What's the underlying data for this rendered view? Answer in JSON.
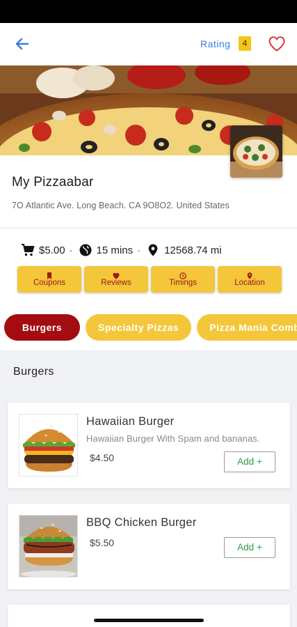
{
  "header": {
    "rating_label": "Rating",
    "rating_value": "4"
  },
  "store": {
    "name": "My Pizzaabar",
    "address": "7O Atlantic Ave. Long Beach. CA 9O8O2. United States"
  },
  "meta": {
    "price": "$5.00",
    "time": "15 mins",
    "distance": "12568.74 mi"
  },
  "actions": [
    {
      "label": "Coupons",
      "icon": "bookmark-icon"
    },
    {
      "label": "Reviews",
      "icon": "heart-icon"
    },
    {
      "label": "Timings",
      "icon": "clock-icon"
    },
    {
      "label": "Location",
      "icon": "pin-icon"
    }
  ],
  "categories": [
    {
      "label": "Burgers",
      "active": true
    },
    {
      "label": "Specialty Pizzas",
      "active": false
    },
    {
      "label": "Pizza Mania Comb",
      "active": false
    }
  ],
  "section": {
    "title": "Burgers"
  },
  "items": [
    {
      "name": "Hawaiian Burger",
      "description": "Hawaiian Burger With Spam and bananas.",
      "price": "$4.50",
      "add_label": "Add +"
    },
    {
      "name": "BBQ Chicken Burger",
      "description": "",
      "price": "$5.50",
      "add_label": "Add +"
    }
  ],
  "colors": {
    "accent_red": "#a30d10",
    "accent_yellow": "#f4c639",
    "link_blue": "#3b7ddd",
    "add_green": "#2e9b46"
  }
}
